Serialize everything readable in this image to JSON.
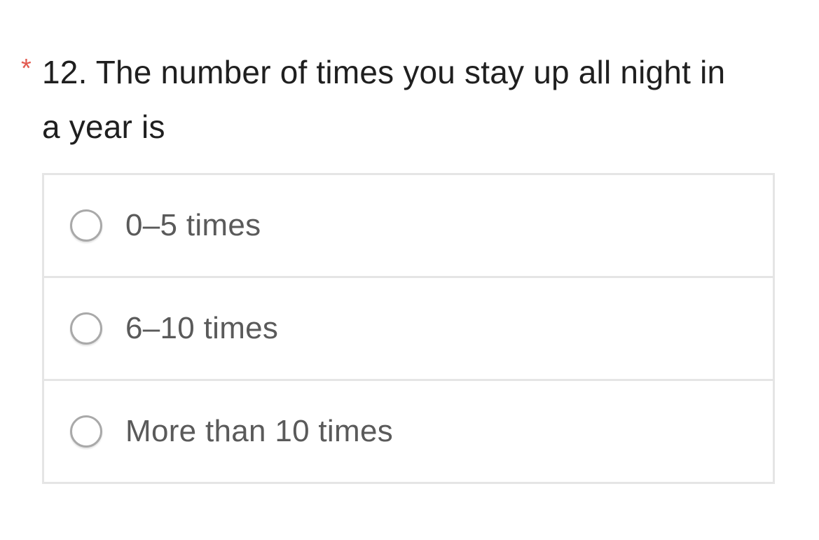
{
  "question": {
    "required_marker": "*",
    "title": "12. The number of times you stay up all night in a year is"
  },
  "options": [
    {
      "label": "0–5 times",
      "selected": false
    },
    {
      "label": "6–10 times",
      "selected": false
    },
    {
      "label": "More than 10 times",
      "selected": false
    }
  ],
  "colors": {
    "required": "#e25a50",
    "title_text": "#1f1f1f",
    "option_text": "#5a5a5a",
    "border": "#e5e5e5",
    "radio_border": "#a9a9a9"
  }
}
